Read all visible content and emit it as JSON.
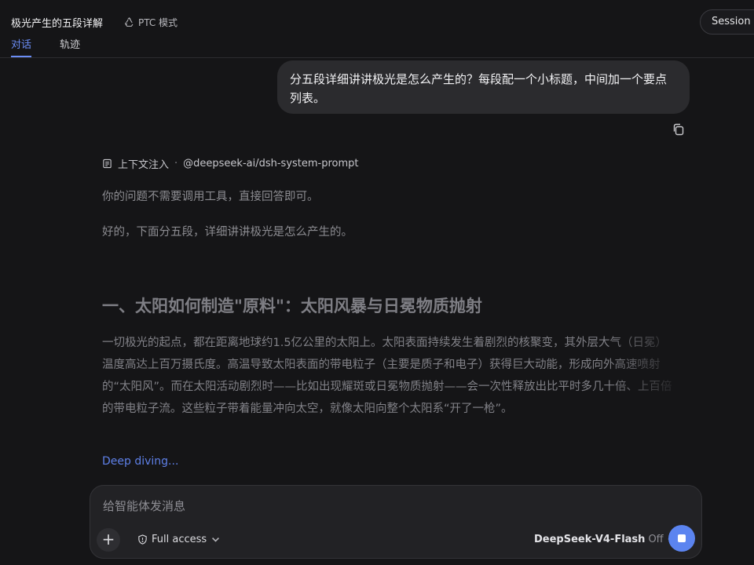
{
  "header": {
    "title": "极光产生的五段详解",
    "mode": "PTC 模式",
    "session_button": "Session lo"
  },
  "tabs": [
    {
      "label": "对话",
      "active": true
    },
    {
      "label": "轨迹",
      "active": false
    }
  ],
  "conversation": {
    "user_message": "分五段详细讲讲极光是怎么产生的？每段配一个小标题，中间加一个要点列表。",
    "context_label": "上下文注入",
    "context_separator": "·",
    "context_source": "@deepseek-ai/dsh-system-prompt",
    "reply_p1": "你的问题不需要调用工具，直接回答即可。",
    "reply_p2": "好的，下面分五段，详细讲讲极光是怎么产生的。",
    "section1_heading": "一、太阳如何制造\"原料\"：太阳风暴与日冕物质抛射",
    "section1_body": "一切极光的起点，都在距离地球约1.5亿公里的太阳上。太阳表面持续发生着剧烈的核聚变，其外层大气（日冕）温度高达上百万摄氏度。高温导致太阳表面的带电粒子（主要是质子和电子）获得巨大动能，形成向外高速喷射的“太阳风”。而在太阳活动剧烈时——比如出现耀斑或日冕物质抛射——会一次性释放出比平时多几十倍、上百倍的带电粒子流。这些粒子带着能量冲向太空，就像太阳向整个太阳系“开了一枪”。",
    "status": "Deep diving..."
  },
  "composer": {
    "placeholder": "给智能体发消息",
    "value": "",
    "plus_label": "+",
    "access_label": "Full access",
    "model_name": "DeepSeek-V4-Flash",
    "thinking_state": "Off"
  },
  "colors": {
    "accent": "#5b84f0",
    "tab_active": "#6b8df5",
    "background": "#151517"
  }
}
